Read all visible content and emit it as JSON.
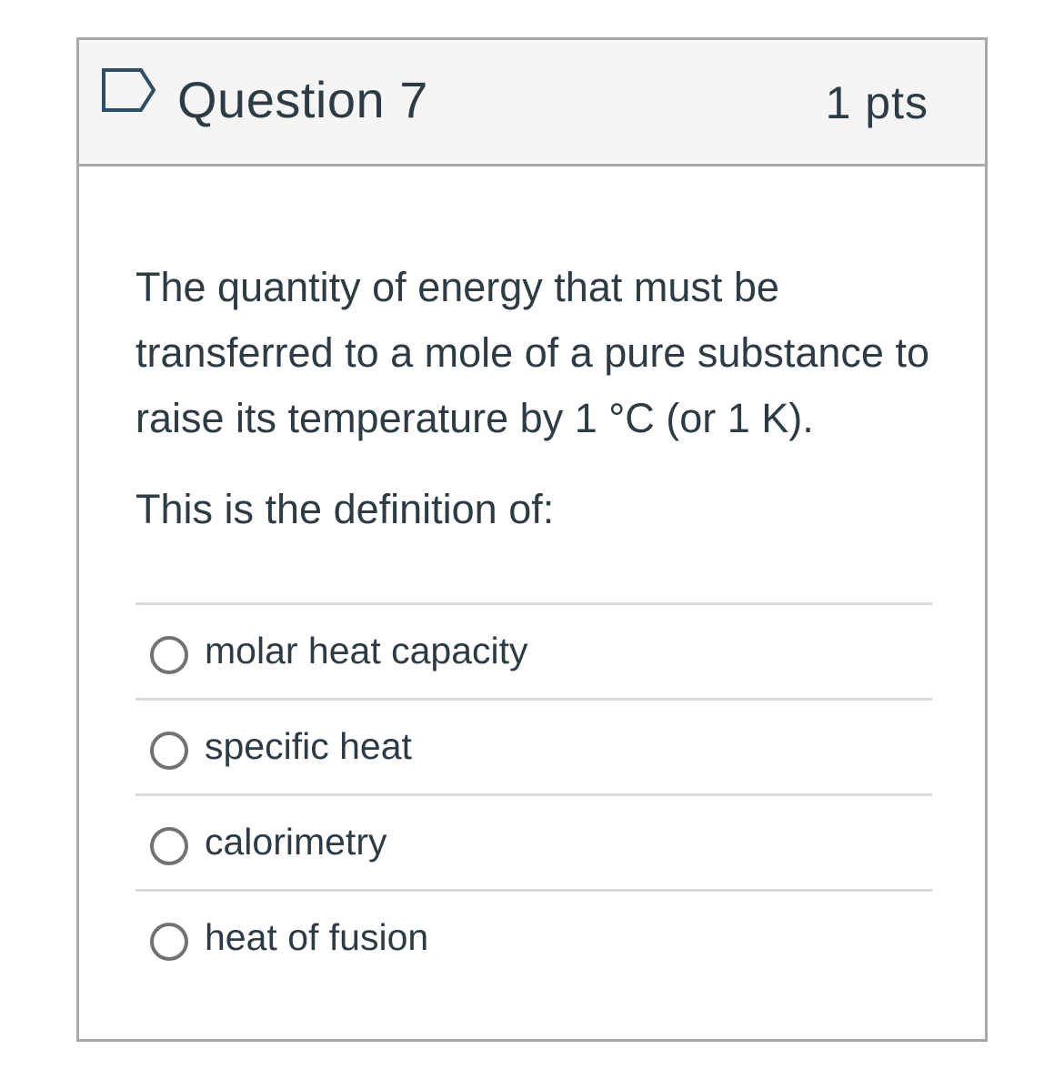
{
  "question": {
    "title": "Question 7",
    "points": "1 pts",
    "flag_icon": "flag-outline-icon",
    "text": "The quantity of energy that must be transferred to a mole of a pure substance to raise its temperature by 1 °C (or 1 K).",
    "prompt": "This is the definition of:"
  },
  "answers": [
    {
      "label": "molar heat capacity",
      "selected": false
    },
    {
      "label": "specific heat",
      "selected": false
    },
    {
      "label": "calorimetry",
      "selected": false
    },
    {
      "label": "heat of fusion",
      "selected": false
    }
  ],
  "colors": {
    "text": "#2d3b45",
    "header_bg": "#f5f5f5",
    "border": "#a8a8a8",
    "divider": "#d9d9d9",
    "radio": "#727272",
    "flag": "#2d4e66"
  }
}
